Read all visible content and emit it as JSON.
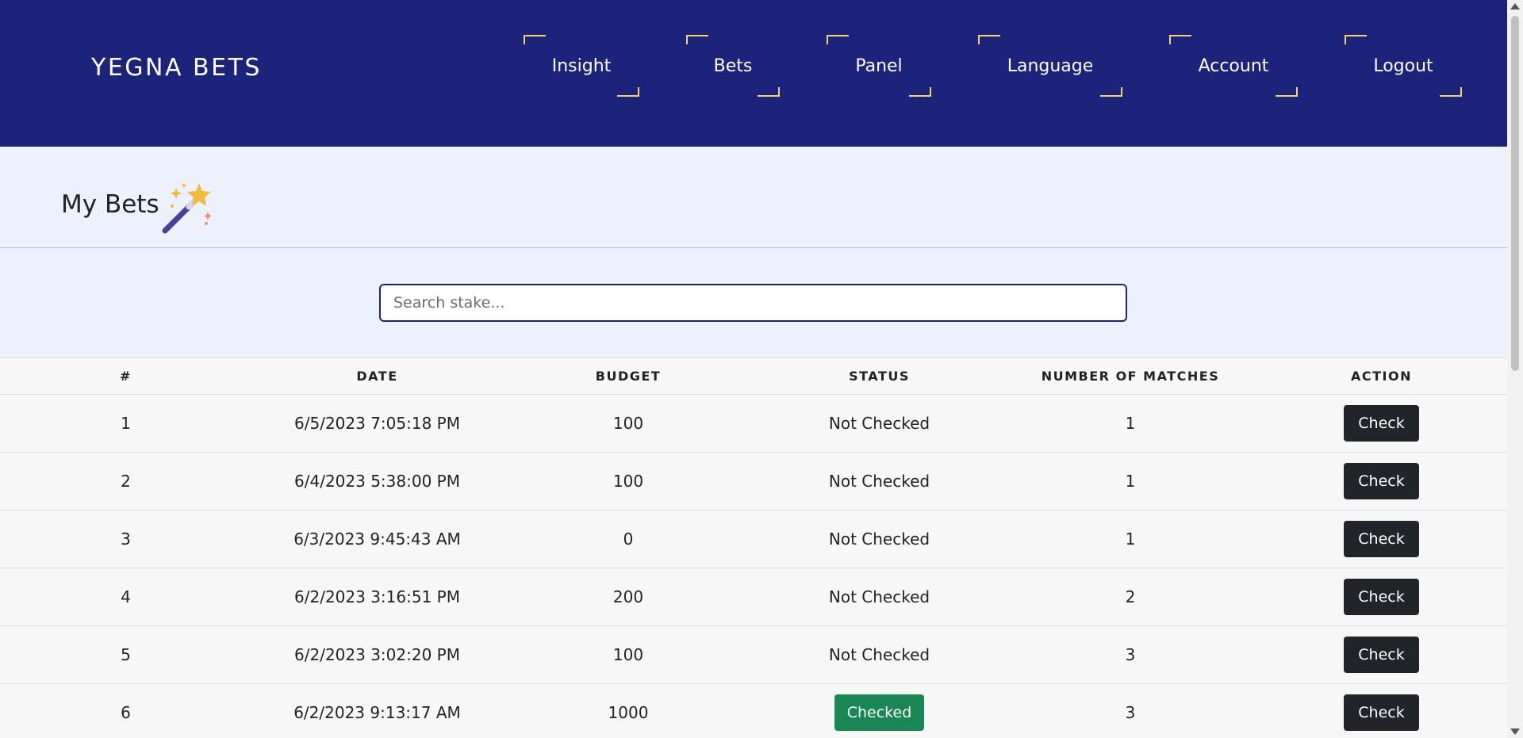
{
  "header": {
    "brand": "YEGNA BETS",
    "nav": [
      "Insight",
      "Bets",
      "Panel",
      "Language",
      "Account",
      "Logout"
    ],
    "background_color": "#1c237a",
    "accent_color": "#f3d36a"
  },
  "page": {
    "title": "My Bets",
    "title_icon": "magic-wand-icon"
  },
  "search": {
    "placeholder": "Search stake...",
    "value": ""
  },
  "table": {
    "columns": [
      "#",
      "DATE",
      "BUDGET",
      "STATUS",
      "NUMBER OF MATCHES",
      "ACTION"
    ],
    "rows": [
      {
        "num": "1",
        "date": "6/5/2023 7:05:18 PM",
        "budget": "100",
        "status": "Not Checked",
        "matches": "1",
        "action": "Check"
      },
      {
        "num": "2",
        "date": "6/4/2023 5:38:00 PM",
        "budget": "100",
        "status": "Not Checked",
        "matches": "1",
        "action": "Check"
      },
      {
        "num": "3",
        "date": "6/3/2023 9:45:43 AM",
        "budget": "0",
        "status": "Not Checked",
        "matches": "1",
        "action": "Check"
      },
      {
        "num": "4",
        "date": "6/2/2023 3:16:51 PM",
        "budget": "200",
        "status": "Not Checked",
        "matches": "2",
        "action": "Check"
      },
      {
        "num": "5",
        "date": "6/2/2023 3:02:20 PM",
        "budget": "100",
        "status": "Not Checked",
        "matches": "3",
        "action": "Check"
      },
      {
        "num": "6",
        "date": "6/2/2023 9:13:17 AM",
        "budget": "1000",
        "status": "Checked",
        "matches": "3",
        "action": "Check"
      }
    ],
    "checked_color": "#198754",
    "button_color": "#212529"
  }
}
